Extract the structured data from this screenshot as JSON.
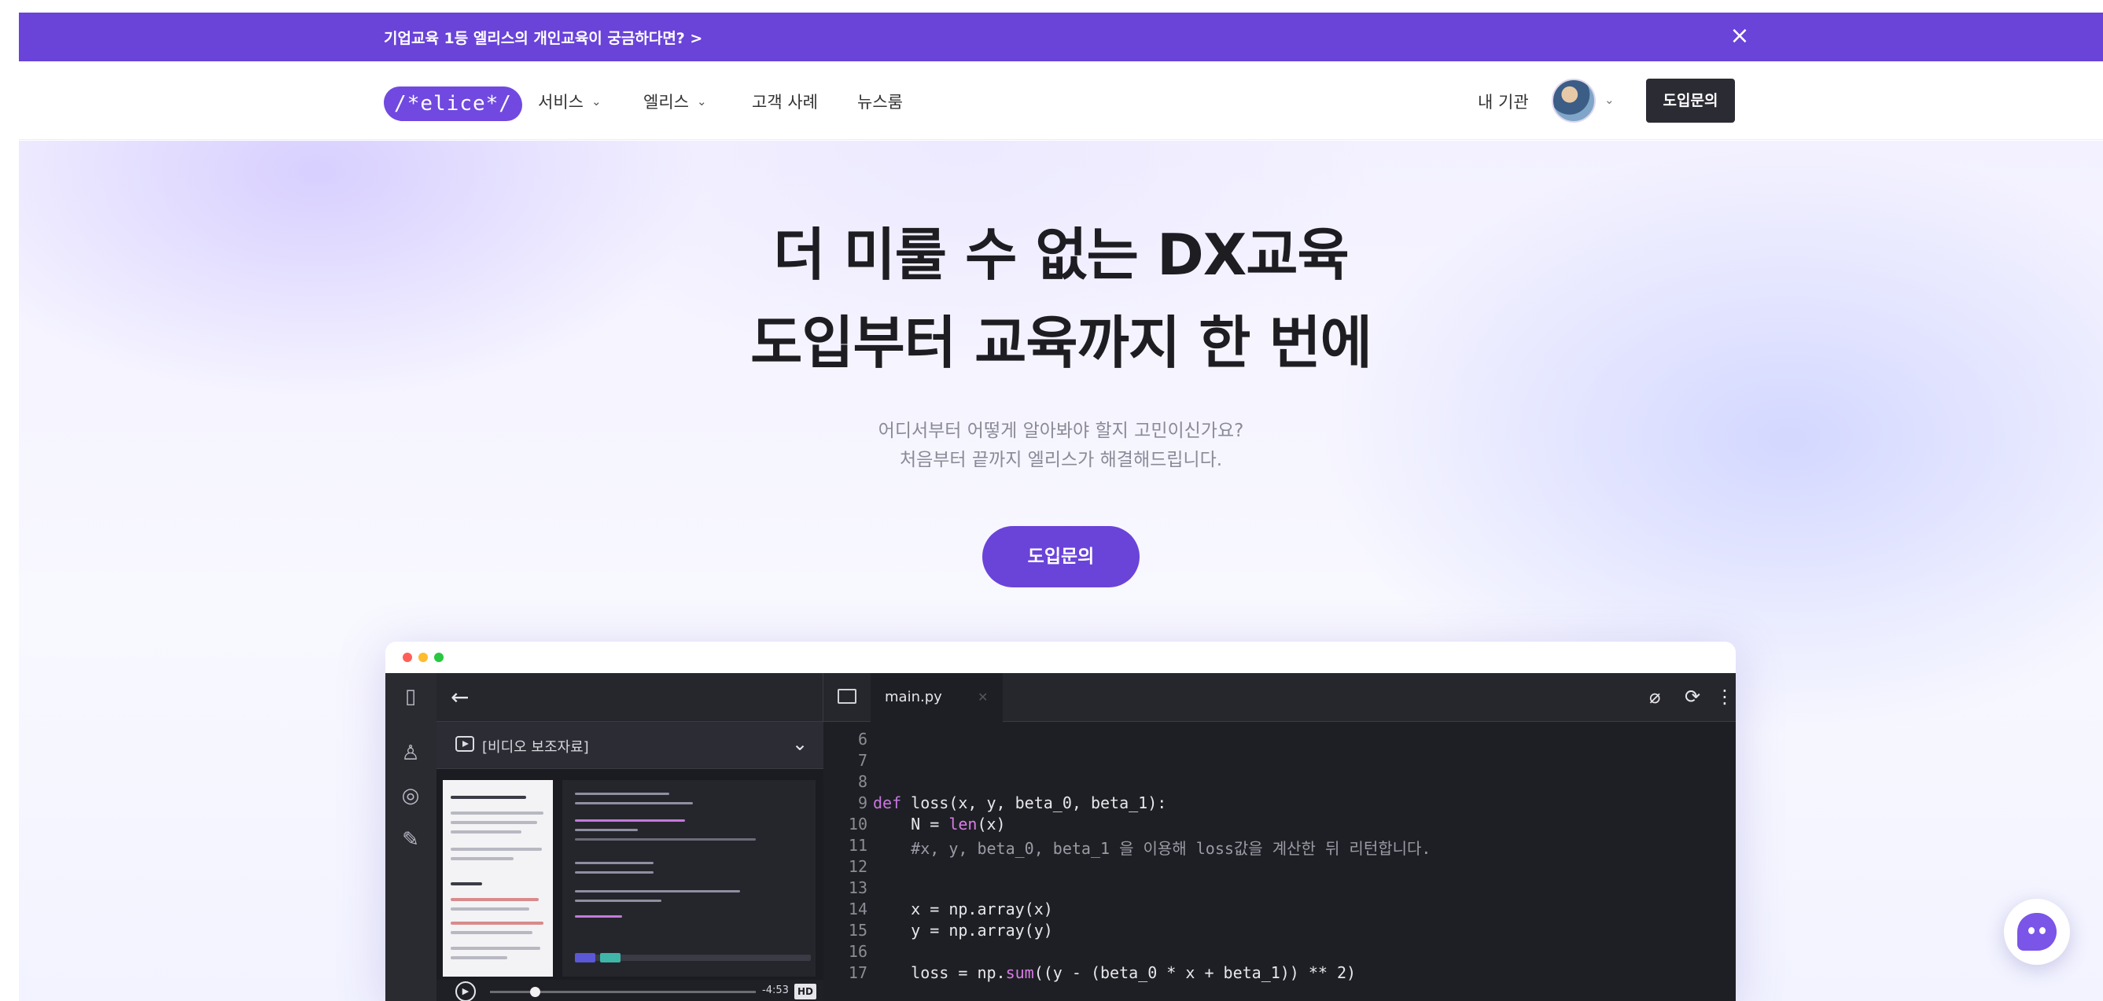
{
  "banner": {
    "text": "기업교육 1등 엘리스의 개인교육이 궁금하다면? >",
    "close_icon": "×"
  },
  "nav": {
    "logo": "/*elice*/",
    "items": [
      {
        "label": "서비스",
        "has_dropdown": true
      },
      {
        "label": "엘리스",
        "has_dropdown": true
      },
      {
        "label": "고객 사례",
        "has_dropdown": false
      },
      {
        "label": "뉴스룸",
        "has_dropdown": false
      }
    ],
    "my_org": "내 기관",
    "cta": "도입문의"
  },
  "hero": {
    "title_line1": "더 미룰 수 없는 DX교육",
    "title_line2": "도입부터 교육까지 한 번에",
    "sub_line1": "어디서부터 어떻게 알아봐야 할지 고민이신가요?",
    "sub_line2": "처음부터 끝까지 엘리스가 해결해드립니다.",
    "cta": "도입문의"
  },
  "app": {
    "video_select": "[비디오 보조자료]",
    "player_time": "-4:53",
    "player_quality": "HD",
    "tab_name": "main.py",
    "code_lines": [
      {
        "n": "6",
        "t": ""
      },
      {
        "n": "7",
        "t": ""
      },
      {
        "n": "8",
        "t": ""
      },
      {
        "n": "9",
        "kw": "def",
        "t": " loss(x, y, beta_0, beta_1):"
      },
      {
        "n": "10",
        "t": "    N = ",
        "fn": "len",
        "rest": "(x)"
      },
      {
        "n": "11",
        "cmt": "    #x, y, beta_0, beta_1 을 이용해 loss값을 계산한 뒤 리턴합니다."
      },
      {
        "n": "12",
        "t": ""
      },
      {
        "n": "13",
        "t": ""
      },
      {
        "n": "14",
        "t": "    x = np.array(x)"
      },
      {
        "n": "15",
        "t": "    y = np.array(y)"
      },
      {
        "n": "16",
        "t": ""
      },
      {
        "n": "17",
        "t": "    loss = np.",
        "fn": "sum",
        "rest": "((y - (beta_0 * x + beta_1)) ** 2)"
      }
    ]
  },
  "colors": {
    "brand": "#6a43d9",
    "dark": "#2b2b33",
    "editor_bg": "#1e1f24"
  },
  "icons": [
    "close-icon",
    "chevron-down-icon",
    "back-arrow-icon",
    "book-icon",
    "person-icon",
    "check-circle-icon",
    "pencil-icon",
    "folder-icon",
    "attach-icon",
    "refresh-icon",
    "more-vert-icon",
    "play-icon",
    "chatbot-icon"
  ]
}
